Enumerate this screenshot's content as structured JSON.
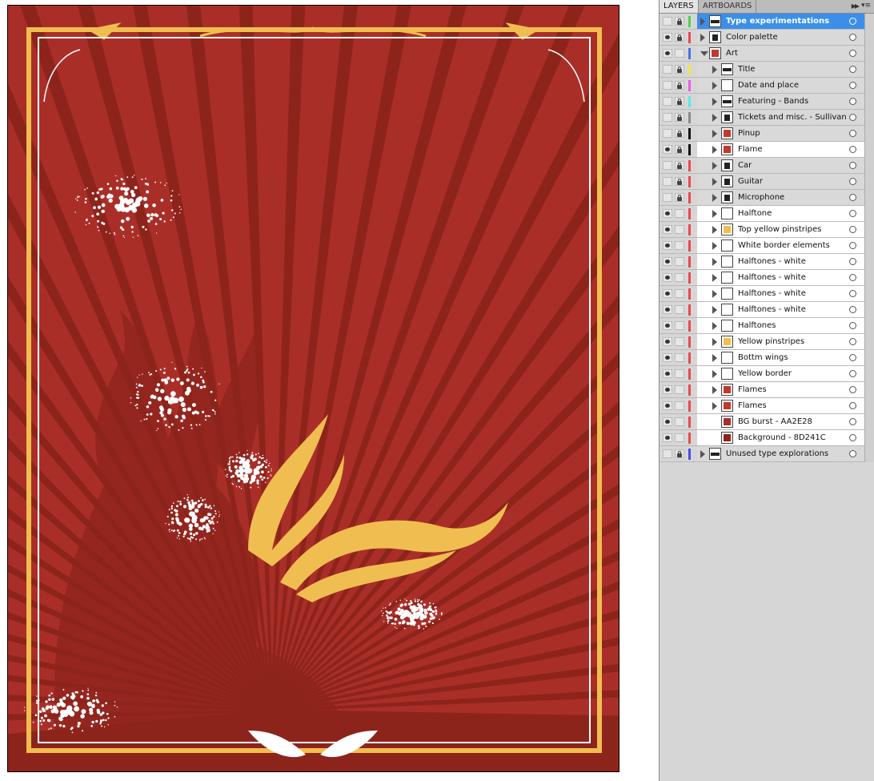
{
  "tabs": [
    {
      "label": "LAYERS",
      "active": true
    },
    {
      "label": "ARTBOARDS",
      "active": false
    }
  ],
  "icons": {
    "collapse": "double-chevron-right-icon",
    "menu": "panel-menu-icon",
    "visibility": "eye-icon",
    "lock": "lock-icon",
    "expand": "disclosure-triangle-icon",
    "target": "target-circle-icon"
  },
  "colors": {
    "artboard_background": "#8D241C",
    "bg_burst": "#AA2E28",
    "yellow": "#F0BE50",
    "selection": "#3B8FE8"
  },
  "layers": [
    {
      "name": "Type experimentations",
      "level": 0,
      "visible": false,
      "locked": true,
      "color": "#4fd14f",
      "expanded": false,
      "selected": true,
      "thumb": "type"
    },
    {
      "name": "Color palette",
      "level": 0,
      "visible": true,
      "locked": true,
      "color": "#e84a4a",
      "expanded": false,
      "selected": false,
      "thumb": "palette"
    },
    {
      "name": "Art",
      "level": 0,
      "visible": true,
      "locked": false,
      "color": "#4a6fe8",
      "expanded": true,
      "selected": false,
      "thumb": "art"
    },
    {
      "name": "Title",
      "level": 1,
      "visible": false,
      "locked": true,
      "color": "#f2e64a",
      "expanded": false,
      "selected": false,
      "thumb": "type"
    },
    {
      "name": "Date and place",
      "level": 1,
      "visible": false,
      "locked": true,
      "color": "#e85be8",
      "expanded": false,
      "selected": false,
      "thumb": "blank"
    },
    {
      "name": "Featuring - Bands",
      "level": 1,
      "visible": false,
      "locked": true,
      "color": "#5be8e8",
      "expanded": false,
      "selected": false,
      "thumb": "type"
    },
    {
      "name": "Tickets and misc. - Sullivan",
      "level": 1,
      "visible": false,
      "locked": true,
      "color": "#8a8a8a",
      "expanded": false,
      "selected": false,
      "thumb": "ticket"
    },
    {
      "name": "Pinup",
      "level": 1,
      "visible": false,
      "locked": true,
      "color": "#111111",
      "expanded": false,
      "selected": false,
      "thumb": "pinup"
    },
    {
      "name": "Flame",
      "level": 1,
      "visible": true,
      "locked": true,
      "color": "#111111",
      "expanded": false,
      "selected": false,
      "white": true,
      "thumb": "flame"
    },
    {
      "name": "Car",
      "level": 1,
      "visible": false,
      "locked": true,
      "color": "#e84a4a",
      "expanded": false,
      "selected": false,
      "thumb": "car"
    },
    {
      "name": "Guitar",
      "level": 1,
      "visible": false,
      "locked": true,
      "color": "#e84a4a",
      "expanded": false,
      "selected": false,
      "thumb": "guitar"
    },
    {
      "name": "Microphone",
      "level": 1,
      "visible": false,
      "locked": true,
      "color": "#e84a4a",
      "expanded": false,
      "selected": false,
      "thumb": "mic"
    },
    {
      "name": "Halftone",
      "level": 1,
      "visible": true,
      "locked": false,
      "color": "#e84a4a",
      "expanded": false,
      "selected": false,
      "white": true,
      "thumb": "blank"
    },
    {
      "name": "Top yellow pinstripes",
      "level": 1,
      "visible": true,
      "locked": false,
      "color": "#e84a4a",
      "expanded": false,
      "selected": false,
      "white": true,
      "thumb": "yellow"
    },
    {
      "name": "White border elements",
      "level": 1,
      "visible": true,
      "locked": false,
      "color": "#e84a4a",
      "expanded": false,
      "selected": false,
      "white": true,
      "thumb": "blank"
    },
    {
      "name": "Halftones - white",
      "level": 1,
      "visible": true,
      "locked": false,
      "color": "#e84a4a",
      "expanded": false,
      "selected": false,
      "white": true,
      "thumb": "blank"
    },
    {
      "name": "Halftones - white",
      "level": 1,
      "visible": true,
      "locked": false,
      "color": "#e84a4a",
      "expanded": false,
      "selected": false,
      "white": true,
      "thumb": "blank"
    },
    {
      "name": "Halftones - white",
      "level": 1,
      "visible": true,
      "locked": false,
      "color": "#e84a4a",
      "expanded": false,
      "selected": false,
      "white": true,
      "thumb": "blank"
    },
    {
      "name": "Halftones - white",
      "level": 1,
      "visible": true,
      "locked": false,
      "color": "#e84a4a",
      "expanded": false,
      "selected": false,
      "white": true,
      "thumb": "blank"
    },
    {
      "name": "Halftones",
      "level": 1,
      "visible": true,
      "locked": false,
      "color": "#e84a4a",
      "expanded": false,
      "selected": false,
      "white": true,
      "thumb": "blank"
    },
    {
      "name": "Yellow pinstripes",
      "level": 1,
      "visible": true,
      "locked": false,
      "color": "#e84a4a",
      "expanded": false,
      "selected": false,
      "white": true,
      "thumb": "yellow"
    },
    {
      "name": "Bottm wings",
      "level": 1,
      "visible": true,
      "locked": false,
      "color": "#e84a4a",
      "expanded": false,
      "selected": false,
      "white": true,
      "thumb": "blank"
    },
    {
      "name": "Yellow border",
      "level": 1,
      "visible": true,
      "locked": false,
      "color": "#e84a4a",
      "expanded": false,
      "selected": false,
      "white": true,
      "thumb": "blank"
    },
    {
      "name": "Flames",
      "level": 1,
      "visible": true,
      "locked": false,
      "color": "#e84a4a",
      "expanded": false,
      "selected": false,
      "white": true,
      "thumb": "flame"
    },
    {
      "name": "Flames",
      "level": 1,
      "visible": true,
      "locked": false,
      "color": "#e84a4a",
      "expanded": false,
      "selected": false,
      "white": true,
      "thumb": "flame"
    },
    {
      "name": "BG burst - AA2E28",
      "level": 1,
      "visible": true,
      "locked": false,
      "color": "#e84a4a",
      "expanded": null,
      "selected": false,
      "white": true,
      "thumb": "burst"
    },
    {
      "name": "Background - 8D241C",
      "level": 1,
      "visible": true,
      "locked": false,
      "color": "#e84a4a",
      "expanded": null,
      "selected": false,
      "white": true,
      "thumb": "bg"
    },
    {
      "name": "Unused type explorations",
      "level": 0,
      "visible": false,
      "locked": true,
      "color": "#4a4ae8",
      "expanded": false,
      "selected": false,
      "thumb": "type"
    }
  ]
}
